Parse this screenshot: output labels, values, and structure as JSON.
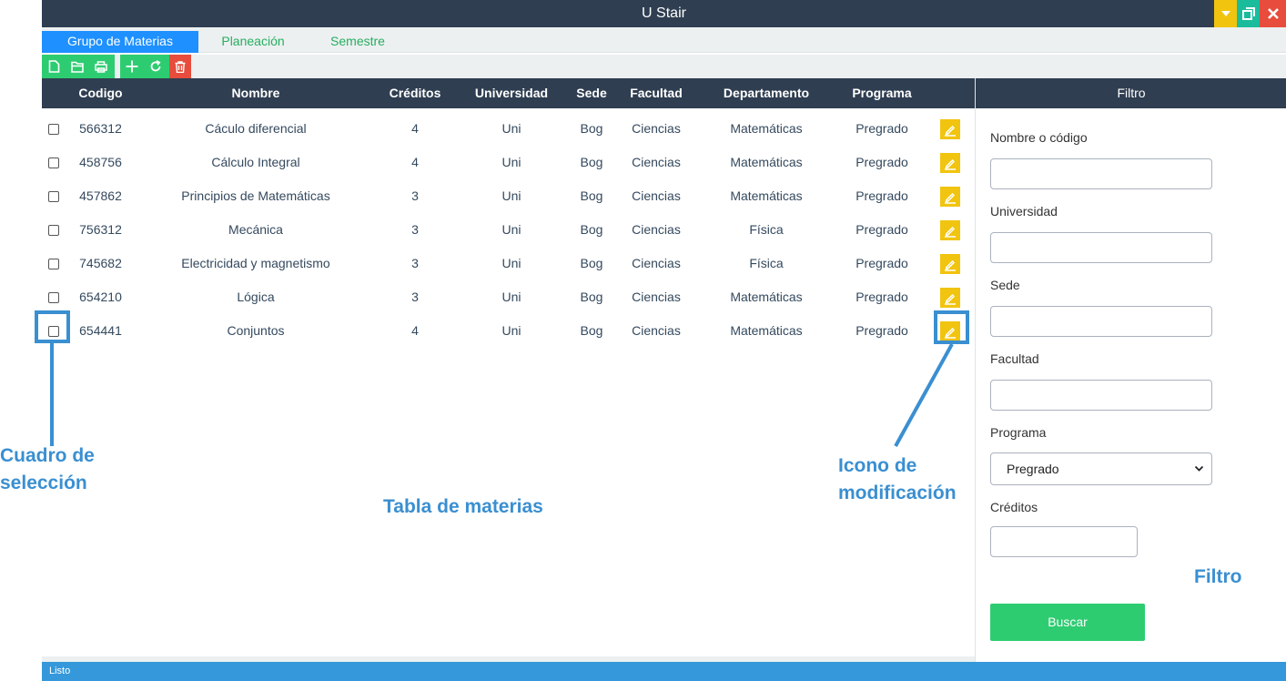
{
  "window": {
    "title": "U Stair",
    "controls": {
      "minimize": "chevron-down-icon",
      "restore": "restore-icon",
      "close": "close-icon"
    }
  },
  "tabs": [
    {
      "label": "Grupo de Materias",
      "active": true
    },
    {
      "label": "Planeación",
      "active": false
    },
    {
      "label": "Semestre",
      "active": false
    }
  ],
  "toolbar": {
    "buttons": [
      "new-file-icon",
      "open-folder-icon",
      "print-icon",
      "add-icon",
      "refresh-icon",
      "delete-icon"
    ]
  },
  "table": {
    "headers": {
      "codigo": "Codigo",
      "nombre": "Nombre",
      "creditos": "Créditos",
      "universidad": "Universidad",
      "sede": "Sede",
      "facultad": "Facultad",
      "departamento": "Departamento",
      "programa": "Programa"
    },
    "rows": [
      {
        "codigo": "566312",
        "nombre": "Cáculo diferencial",
        "creditos": "4",
        "universidad": "Uni",
        "sede": "Bog",
        "facultad": "Ciencias",
        "departamento": "Matemáticas",
        "programa": "Pregrado"
      },
      {
        "codigo": "458756",
        "nombre": "Cálculo Integral",
        "creditos": "4",
        "universidad": "Uni",
        "sede": "Bog",
        "facultad": "Ciencias",
        "departamento": "Matemáticas",
        "programa": "Pregrado"
      },
      {
        "codigo": "457862",
        "nombre": "Principios de Matemáticas",
        "creditos": "3",
        "universidad": "Uni",
        "sede": "Bog",
        "facultad": "Ciencias",
        "departamento": "Matemáticas",
        "programa": "Pregrado"
      },
      {
        "codigo": "756312",
        "nombre": "Mecánica",
        "creditos": "3",
        "universidad": "Uni",
        "sede": "Bog",
        "facultad": "Ciencias",
        "departamento": "Física",
        "programa": "Pregrado"
      },
      {
        "codigo": "745682",
        "nombre": "Electricidad y magnetismo",
        "creditos": "3",
        "universidad": "Uni",
        "sede": "Bog",
        "facultad": "Ciencias",
        "departamento": "Física",
        "programa": "Pregrado"
      },
      {
        "codigo": "654210",
        "nombre": "Lógica",
        "creditos": "3",
        "universidad": "Uni",
        "sede": "Bog",
        "facultad": "Ciencias",
        "departamento": "Matemáticas",
        "programa": "Pregrado"
      },
      {
        "codigo": "654441",
        "nombre": "Conjuntos",
        "creditos": "4",
        "universidad": "Uni",
        "sede": "Bog",
        "facultad": "Ciencias",
        "departamento": "Matemáticas",
        "programa": "Pregrado"
      }
    ]
  },
  "filter": {
    "title": "Filtro",
    "nombre_label": "Nombre o código",
    "universidad_label": "Universidad",
    "sede_label": "Sede",
    "facultad_label": "Facultad",
    "programa_label": "Programa",
    "programa_value": "Pregrado",
    "creditos_label": "Créditos",
    "search_button": "Buscar"
  },
  "status": {
    "text": "Listo"
  },
  "annotations": {
    "checkbox_label": "Cuadro de\nselección",
    "table_label": "Tabla de materias",
    "edit_label": "Icono de\nmodificación",
    "filter_label": "Filtro"
  },
  "colors": {
    "header_dark": "#2f3e51",
    "accent_blue": "#1e90ff",
    "green": "#2ecc71",
    "red": "#e74c3c",
    "yellow": "#f1c40f",
    "status_blue": "#3498db",
    "annotation_blue": "#3a8fd1"
  }
}
